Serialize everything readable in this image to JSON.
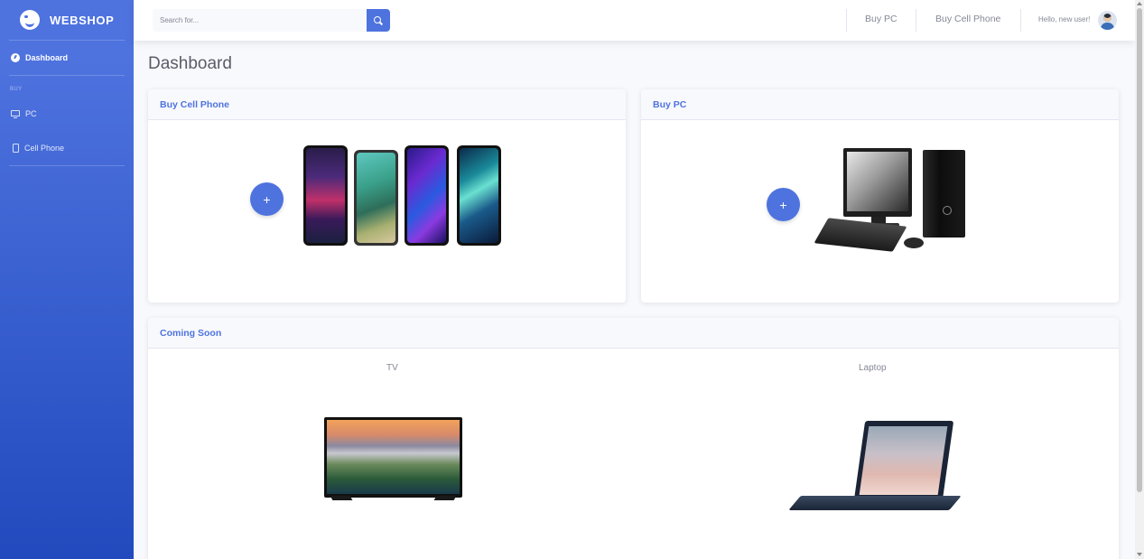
{
  "brand": {
    "name": "WEBSHOP"
  },
  "sidebar": {
    "dashboard_label": "Dashboard",
    "heading": "BUY",
    "items": [
      {
        "label": "PC",
        "icon": "desktop-icon"
      },
      {
        "label": "Cell Phone",
        "icon": "mobile-phone-icon"
      }
    ]
  },
  "topbar": {
    "search_placeholder": "Search for...",
    "nav": [
      {
        "label": "Buy PC"
      },
      {
        "label": "Buy Cell Phone"
      }
    ],
    "greeting": "Hello, new user!"
  },
  "page": {
    "title": "Dashboard"
  },
  "cards": {
    "cell_phone": {
      "title": "Buy Cell Phone",
      "button": "+"
    },
    "pc": {
      "title": "Buy PC",
      "button": "+"
    },
    "coming_soon": {
      "title": "Coming Soon",
      "items": [
        {
          "label": "TV"
        },
        {
          "label": "Laptop"
        }
      ]
    }
  },
  "colors": {
    "accent": "#4e73df",
    "sidebar_bottom": "#224abe",
    "background": "#f8f9fc"
  }
}
